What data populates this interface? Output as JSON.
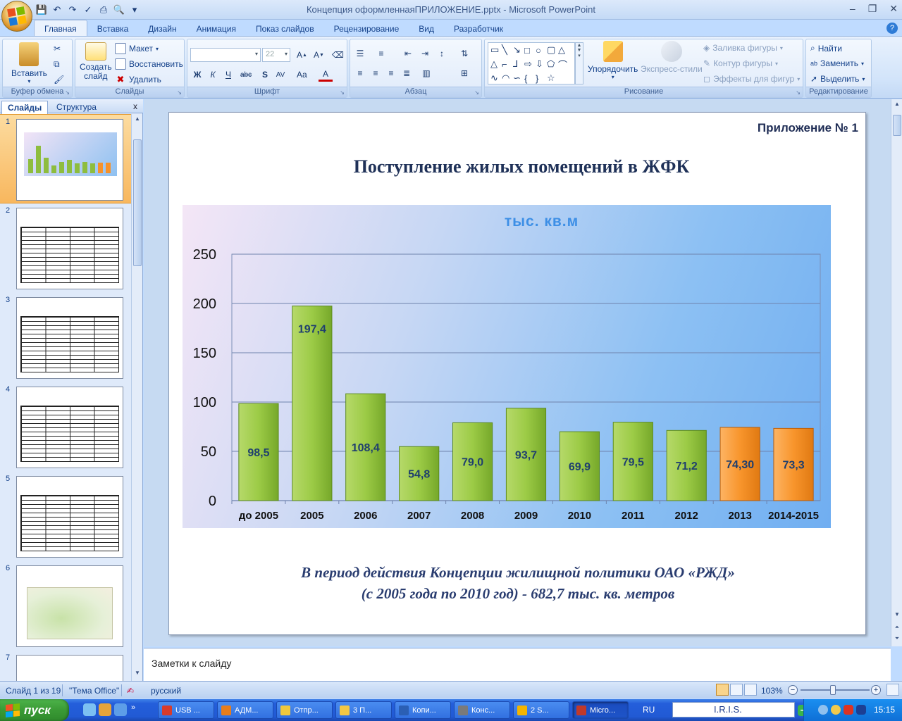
{
  "window": {
    "title": "Концепция оформленнаяПРИЛОЖЕНИЕ.pptx - Microsoft PowerPoint",
    "minimize": "–",
    "maximize": "❐",
    "close": "✕"
  },
  "ribbon_tabs": [
    "Главная",
    "Вставка",
    "Дизайн",
    "Анимация",
    "Показ слайдов",
    "Рецензирование",
    "Вид",
    "Разработчик"
  ],
  "ribbon": {
    "clipboard": {
      "name": "Буфер обмена",
      "paste": "Вставить"
    },
    "slides": {
      "name": "Слайды",
      "new_slide_line1": "Создать",
      "new_slide_line2": "слайд",
      "layout": "Макет",
      "reset": "Восстановить",
      "delete": "Удалить"
    },
    "font": {
      "name": "Шрифт",
      "font_size": "22"
    },
    "paragraph": {
      "name": "Абзац"
    },
    "drawing": {
      "name": "Рисование",
      "arrange": "Упорядочить",
      "quick_styles": "Экспресс-стили",
      "fill": "Заливка фигуры",
      "outline": "Контур фигуры",
      "effects": "Эффекты для фигур"
    },
    "editing": {
      "name": "Редактирование",
      "find": "Найти",
      "replace": "Заменить",
      "select": "Выделить"
    }
  },
  "pane": {
    "tab_slides": "Слайды",
    "tab_outline": "Структура",
    "close": "x",
    "thumbnail_numbers": [
      "1",
      "2",
      "3",
      "4",
      "5",
      "6",
      "7"
    ],
    "selected": "1"
  },
  "slide": {
    "appendix_label": "Приложение № 1",
    "title": "Поступление жилых помещений в ЖФК",
    "caption_line1": "В период действия Концепции жилищной политики ОАО «РЖД»",
    "caption_line2": "(с 2005 года по 2010 год) - 682,7 тыс. кв. метров"
  },
  "chart_data": {
    "type": "bar",
    "title": "тыс. кв.м",
    "categories": [
      "до 2005",
      "2005",
      "2006",
      "2007",
      "2008",
      "2009",
      "2010",
      "2011",
      "2012",
      "2013",
      "2014-2015"
    ],
    "values": [
      98.5,
      197.4,
      108.4,
      54.8,
      79.0,
      93.7,
      69.9,
      79.5,
      71.2,
      74.3,
      73.3
    ],
    "data_labels": [
      "98,5",
      "197,4",
      "108,4",
      "54,8",
      "79,0",
      "93,7",
      "69,9",
      "79,5",
      "71,2",
      "74,30",
      "73,3"
    ],
    "bar_colors": [
      "#8ebd3e",
      "#8ebd3e",
      "#8ebd3e",
      "#8ebd3e",
      "#8ebd3e",
      "#8ebd3e",
      "#8ebd3e",
      "#8ebd3e",
      "#8ebd3e",
      "#f7922a",
      "#f7922a"
    ],
    "yticks": [
      "0",
      "50",
      "100",
      "150",
      "200",
      "250"
    ],
    "ylim": [
      0,
      250
    ],
    "grid": true,
    "legend": false
  },
  "notes": {
    "placeholder": "Заметки к слайду"
  },
  "status": {
    "slide_counter": "Слайд 1 из 19",
    "theme": "\"Тема Office\"",
    "language": "русский",
    "zoom": "103%"
  },
  "taskbar": {
    "start": "пуск",
    "tasks": [
      "USB ...",
      "АДМ...",
      "Отпр...",
      "3 П...",
      "Копи...",
      "Конс...",
      "2 S...",
      "Micro..."
    ],
    "active_task": "Micro...",
    "lang": "RU",
    "app_box": "I.R.I.S.",
    "clock": "15:15"
  }
}
